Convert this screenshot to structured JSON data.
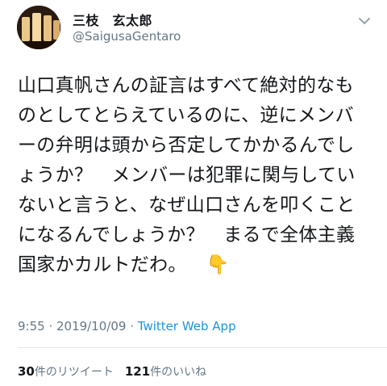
{
  "user": {
    "name": "三枝　玄太郎",
    "handle": "@SaigusaGentaro"
  },
  "tweet": {
    "text": "山口真帆さんの証言はすべて絶対的なものとしてとらえているのに、逆にメンバーの弁明は頭から否定してかかるんでしょうか？　メンバーは犯罪に関与していないと言うと、なぜ山口さんを叩くことになるんでしょうか？　まるで全体主義国家かカルトだわ。",
    "emoji": "👇"
  },
  "meta": {
    "time": "9:55",
    "separator1": " · ",
    "date": "2019/10/09",
    "separator2": " · ",
    "via": "Twitter Web App"
  },
  "stats": {
    "retweets_count": "30",
    "retweets_label": "件のリツイート",
    "likes_count": "121",
    "likes_label": "件のいいね"
  },
  "colors": {
    "link": "#1b95e0",
    "secondary_text": "#657786",
    "divider": "#e1e8ed"
  },
  "icons": {
    "menu": "chevron-down-icon",
    "emoji": "backhand-index-pointing-down"
  }
}
